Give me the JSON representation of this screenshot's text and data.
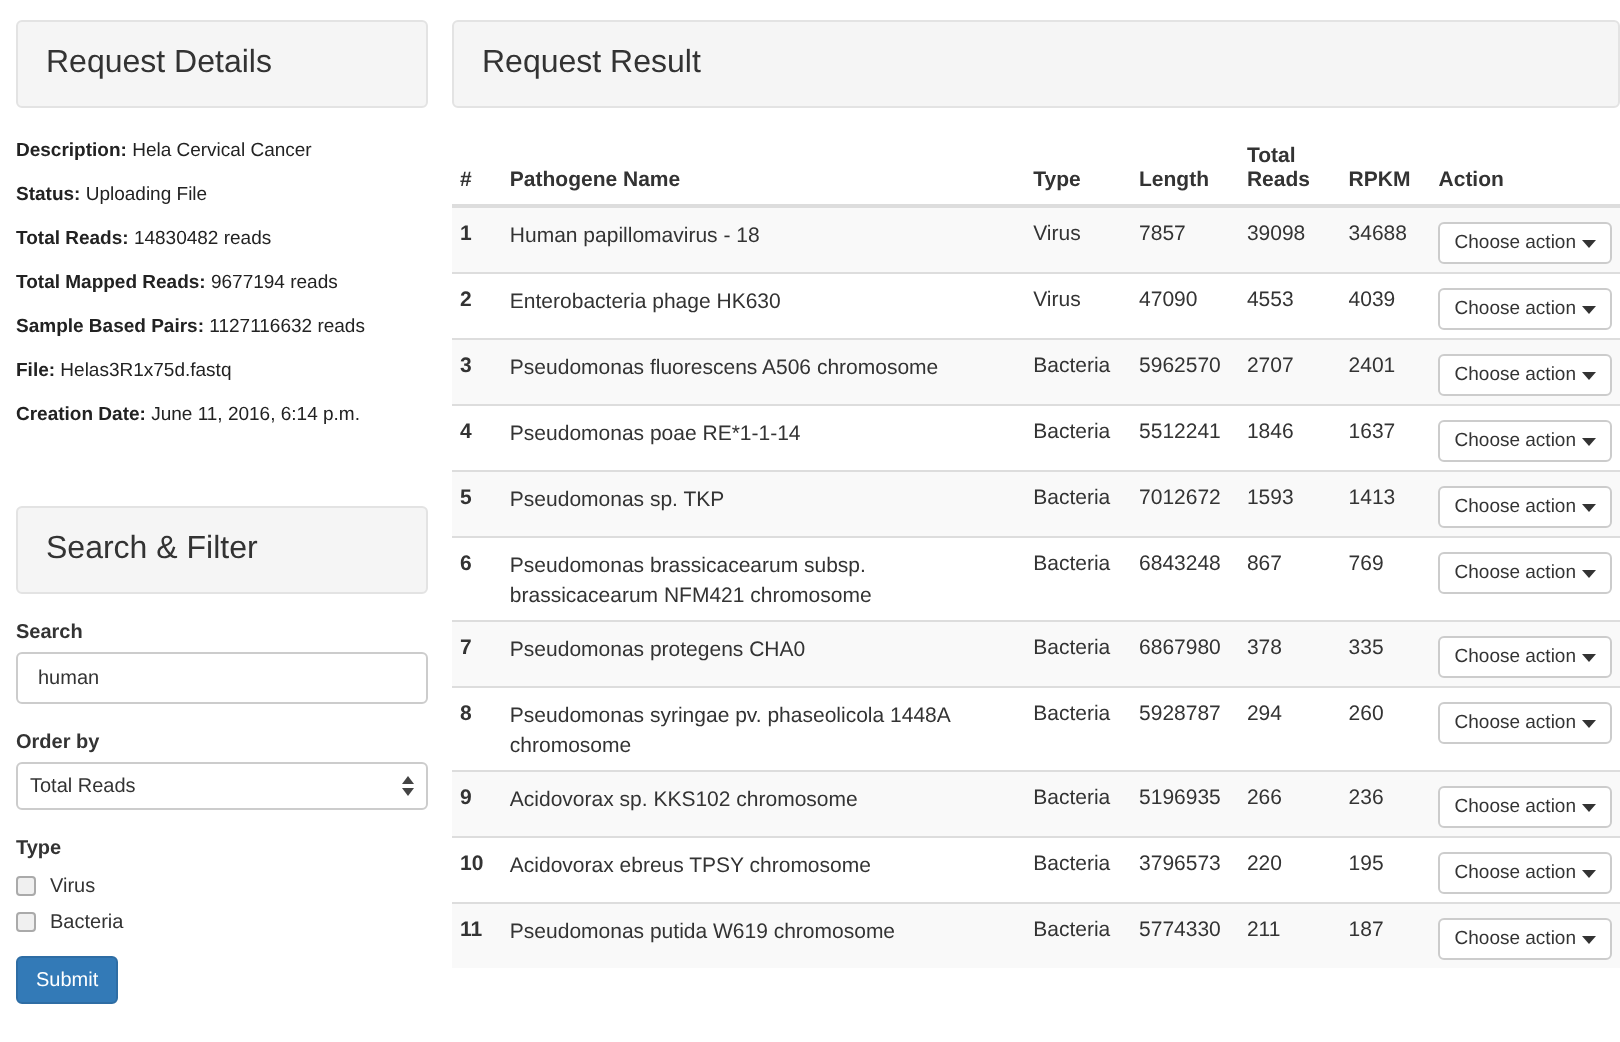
{
  "request_details": {
    "title": "Request Details",
    "fields": [
      {
        "label": "Description:",
        "value": "Hela Cervical Cancer"
      },
      {
        "label": "Status:",
        "value": "Uploading File"
      },
      {
        "label": "Total Reads:",
        "value": "14830482 reads"
      },
      {
        "label": "Total Mapped Reads:",
        "value": "9677194 reads"
      },
      {
        "label": "Sample Based Pairs:",
        "value": "1127116632 reads"
      },
      {
        "label": "File:",
        "value": "Helas3R1x75d.fastq"
      },
      {
        "label": "Creation Date:",
        "value": "June 11, 2016, 6:14 p.m."
      }
    ]
  },
  "search_filter": {
    "title": "Search & Filter",
    "search_label": "Search",
    "search_value": "human",
    "order_label": "Order by",
    "order_value": "Total Reads",
    "type_label": "Type",
    "types": [
      {
        "label": "Virus",
        "checked": false
      },
      {
        "label": "Bacteria",
        "checked": false
      }
    ],
    "submit": "Submit"
  },
  "request_result": {
    "title": "Request Result",
    "columns": [
      "#",
      "Pathogene Name",
      "Type",
      "Length",
      "Total Reads",
      "RPKM",
      "Action"
    ],
    "rows": [
      {
        "index": "1",
        "name": "Human papillomavirus - 18",
        "type": "Virus",
        "length": "7857",
        "total_reads": "39098",
        "rpkm": "34688",
        "action": "Choose action"
      },
      {
        "index": "2",
        "name": "Enterobacteria phage HK630",
        "type": "Virus",
        "length": "47090",
        "total_reads": "4553",
        "rpkm": "4039",
        "action": "Choose action"
      },
      {
        "index": "3",
        "name": "Pseudomonas fluorescens A506 chromosome",
        "type": "Bacteria",
        "length": "5962570",
        "total_reads": "2707",
        "rpkm": "2401",
        "action": "Choose action"
      },
      {
        "index": "4",
        "name": "Pseudomonas poae RE*1-1-14",
        "type": "Bacteria",
        "length": "5512241",
        "total_reads": "1846",
        "rpkm": "1637",
        "action": "Choose action"
      },
      {
        "index": "5",
        "name": "Pseudomonas sp. TKP",
        "type": "Bacteria",
        "length": "7012672",
        "total_reads": "1593",
        "rpkm": "1413",
        "action": "Choose action"
      },
      {
        "index": "6",
        "name": "Pseudomonas brassicacearum subsp. brassicacearum NFM421 chromosome",
        "type": "Bacteria",
        "length": "6843248",
        "total_reads": "867",
        "rpkm": "769",
        "action": "Choose action"
      },
      {
        "index": "7",
        "name": "Pseudomonas protegens CHA0",
        "type": "Bacteria",
        "length": "6867980",
        "total_reads": "378",
        "rpkm": "335",
        "action": "Choose action"
      },
      {
        "index": "8",
        "name": "Pseudomonas syringae pv. phaseolicola 1448A chromosome",
        "type": "Bacteria",
        "length": "5928787",
        "total_reads": "294",
        "rpkm": "260",
        "action": "Choose action"
      },
      {
        "index": "9",
        "name": "Acidovorax sp. KKS102 chromosome",
        "type": "Bacteria",
        "length": "5196935",
        "total_reads": "266",
        "rpkm": "236",
        "action": "Choose action"
      },
      {
        "index": "10",
        "name": "Acidovorax ebreus TPSY chromosome",
        "type": "Bacteria",
        "length": "3796573",
        "total_reads": "220",
        "rpkm": "195",
        "action": "Choose action"
      },
      {
        "index": "11",
        "name": "Pseudomonas putida W619 chromosome",
        "type": "Bacteria",
        "length": "5774330",
        "total_reads": "211",
        "rpkm": "187",
        "action": "Choose action"
      }
    ]
  }
}
